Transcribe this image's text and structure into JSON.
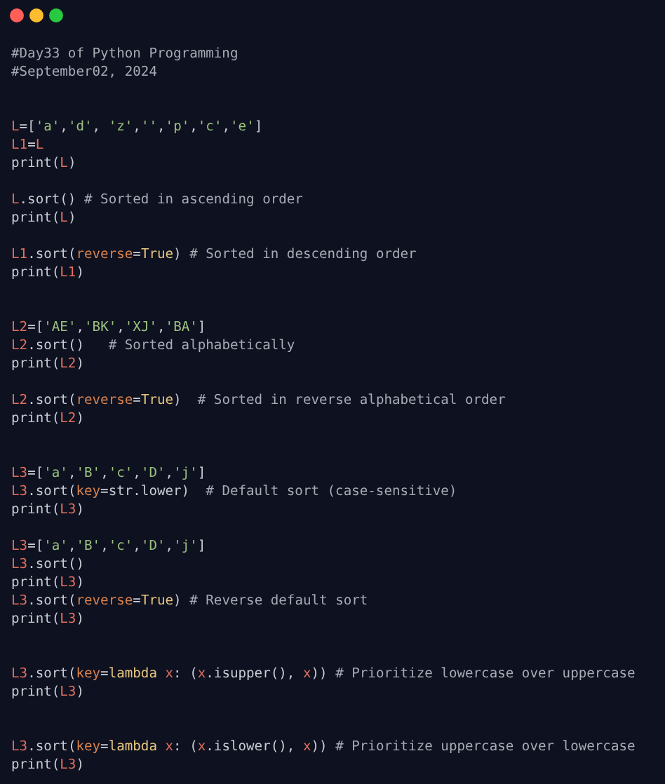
{
  "window": {
    "controls": [
      {
        "kind": "close"
      },
      {
        "kind": "minimize"
      },
      {
        "kind": "maximize"
      }
    ]
  },
  "lines": [
    {
      "kind": "code",
      "tokens": [
        {
          "kind": "comment",
          "text": "#Day33 of Python Programming"
        }
      ]
    },
    {
      "kind": "code",
      "tokens": [
        {
          "kind": "comment",
          "text": "#September02, 2024"
        }
      ]
    },
    {
      "kind": "blank"
    },
    {
      "kind": "blank"
    },
    {
      "kind": "code",
      "tokens": [
        {
          "kind": "var",
          "text": "L"
        },
        {
          "kind": "plain",
          "text": "=["
        },
        {
          "kind": "str",
          "text": "'a'"
        },
        {
          "kind": "plain",
          "text": ","
        },
        {
          "kind": "str",
          "text": "'d'"
        },
        {
          "kind": "plain",
          "text": ", "
        },
        {
          "kind": "str",
          "text": "'z'"
        },
        {
          "kind": "plain",
          "text": ","
        },
        {
          "kind": "str",
          "text": "''"
        },
        {
          "kind": "plain",
          "text": ","
        },
        {
          "kind": "str",
          "text": "'p'"
        },
        {
          "kind": "plain",
          "text": ","
        },
        {
          "kind": "str",
          "text": "'c'"
        },
        {
          "kind": "plain",
          "text": ","
        },
        {
          "kind": "str",
          "text": "'e'"
        },
        {
          "kind": "plain",
          "text": "]"
        }
      ]
    },
    {
      "kind": "code",
      "tokens": [
        {
          "kind": "var",
          "text": "L1"
        },
        {
          "kind": "plain",
          "text": "="
        },
        {
          "kind": "var",
          "text": "L"
        }
      ]
    },
    {
      "kind": "code",
      "tokens": [
        {
          "kind": "plain",
          "text": "print("
        },
        {
          "kind": "var",
          "text": "L"
        },
        {
          "kind": "plain",
          "text": ")"
        }
      ]
    },
    {
      "kind": "blank"
    },
    {
      "kind": "code",
      "tokens": [
        {
          "kind": "var",
          "text": "L"
        },
        {
          "kind": "plain",
          "text": ".sort() "
        },
        {
          "kind": "comment",
          "text": "# Sorted in ascending order"
        }
      ]
    },
    {
      "kind": "code",
      "tokens": [
        {
          "kind": "plain",
          "text": "print("
        },
        {
          "kind": "var",
          "text": "L"
        },
        {
          "kind": "plain",
          "text": ")"
        }
      ]
    },
    {
      "kind": "blank"
    },
    {
      "kind": "code",
      "tokens": [
        {
          "kind": "var",
          "text": "L1"
        },
        {
          "kind": "plain",
          "text": ".sort("
        },
        {
          "kind": "param",
          "text": "reverse"
        },
        {
          "kind": "plain",
          "text": "="
        },
        {
          "kind": "const",
          "text": "True"
        },
        {
          "kind": "plain",
          "text": ") "
        },
        {
          "kind": "comment",
          "text": "# Sorted in descending order"
        }
      ]
    },
    {
      "kind": "code",
      "tokens": [
        {
          "kind": "plain",
          "text": "print("
        },
        {
          "kind": "var",
          "text": "L1"
        },
        {
          "kind": "plain",
          "text": ")"
        }
      ]
    },
    {
      "kind": "blank"
    },
    {
      "kind": "blank"
    },
    {
      "kind": "code",
      "tokens": [
        {
          "kind": "var",
          "text": "L2"
        },
        {
          "kind": "plain",
          "text": "=["
        },
        {
          "kind": "str",
          "text": "'AE'"
        },
        {
          "kind": "plain",
          "text": ","
        },
        {
          "kind": "str",
          "text": "'BK'"
        },
        {
          "kind": "plain",
          "text": ","
        },
        {
          "kind": "str",
          "text": "'XJ'"
        },
        {
          "kind": "plain",
          "text": ","
        },
        {
          "kind": "str",
          "text": "'BA'"
        },
        {
          "kind": "plain",
          "text": "]"
        }
      ]
    },
    {
      "kind": "code",
      "tokens": [
        {
          "kind": "var",
          "text": "L2"
        },
        {
          "kind": "plain",
          "text": ".sort()   "
        },
        {
          "kind": "comment",
          "text": "# Sorted alphabetically"
        }
      ]
    },
    {
      "kind": "code",
      "tokens": [
        {
          "kind": "plain",
          "text": "print("
        },
        {
          "kind": "var",
          "text": "L2"
        },
        {
          "kind": "plain",
          "text": ")"
        }
      ]
    },
    {
      "kind": "blank"
    },
    {
      "kind": "code",
      "tokens": [
        {
          "kind": "var",
          "text": "L2"
        },
        {
          "kind": "plain",
          "text": ".sort("
        },
        {
          "kind": "param",
          "text": "reverse"
        },
        {
          "kind": "plain",
          "text": "="
        },
        {
          "kind": "const",
          "text": "True"
        },
        {
          "kind": "plain",
          "text": ")  "
        },
        {
          "kind": "comment",
          "text": "# Sorted in reverse alphabetical order"
        }
      ]
    },
    {
      "kind": "code",
      "tokens": [
        {
          "kind": "plain",
          "text": "print("
        },
        {
          "kind": "var",
          "text": "L2"
        },
        {
          "kind": "plain",
          "text": ")"
        }
      ]
    },
    {
      "kind": "blank"
    },
    {
      "kind": "blank"
    },
    {
      "kind": "code",
      "tokens": [
        {
          "kind": "var",
          "text": "L3"
        },
        {
          "kind": "plain",
          "text": "=["
        },
        {
          "kind": "str",
          "text": "'a'"
        },
        {
          "kind": "plain",
          "text": ","
        },
        {
          "kind": "str",
          "text": "'B'"
        },
        {
          "kind": "plain",
          "text": ","
        },
        {
          "kind": "str",
          "text": "'c'"
        },
        {
          "kind": "plain",
          "text": ","
        },
        {
          "kind": "str",
          "text": "'D'"
        },
        {
          "kind": "plain",
          "text": ","
        },
        {
          "kind": "str",
          "text": "'j'"
        },
        {
          "kind": "plain",
          "text": "]"
        }
      ]
    },
    {
      "kind": "code",
      "tokens": [
        {
          "kind": "var",
          "text": "L3"
        },
        {
          "kind": "plain",
          "text": ".sort("
        },
        {
          "kind": "param",
          "text": "key"
        },
        {
          "kind": "plain",
          "text": "=str.lower)  "
        },
        {
          "kind": "comment",
          "text": "# Default sort (case-sensitive)"
        }
      ]
    },
    {
      "kind": "code",
      "tokens": [
        {
          "kind": "plain",
          "text": "print("
        },
        {
          "kind": "var",
          "text": "L3"
        },
        {
          "kind": "plain",
          "text": ")"
        }
      ]
    },
    {
      "kind": "blank"
    },
    {
      "kind": "code",
      "tokens": [
        {
          "kind": "var",
          "text": "L3"
        },
        {
          "kind": "plain",
          "text": "=["
        },
        {
          "kind": "str",
          "text": "'a'"
        },
        {
          "kind": "plain",
          "text": ","
        },
        {
          "kind": "str",
          "text": "'B'"
        },
        {
          "kind": "plain",
          "text": ","
        },
        {
          "kind": "str",
          "text": "'c'"
        },
        {
          "kind": "plain",
          "text": ","
        },
        {
          "kind": "str",
          "text": "'D'"
        },
        {
          "kind": "plain",
          "text": ","
        },
        {
          "kind": "str",
          "text": "'j'"
        },
        {
          "kind": "plain",
          "text": "]"
        }
      ]
    },
    {
      "kind": "code",
      "tokens": [
        {
          "kind": "var",
          "text": "L3"
        },
        {
          "kind": "plain",
          "text": ".sort()"
        }
      ]
    },
    {
      "kind": "code",
      "tokens": [
        {
          "kind": "plain",
          "text": "print("
        },
        {
          "kind": "var",
          "text": "L3"
        },
        {
          "kind": "plain",
          "text": ")"
        }
      ]
    },
    {
      "kind": "code",
      "tokens": [
        {
          "kind": "var",
          "text": "L3"
        },
        {
          "kind": "plain",
          "text": ".sort("
        },
        {
          "kind": "param",
          "text": "reverse"
        },
        {
          "kind": "plain",
          "text": "="
        },
        {
          "kind": "const",
          "text": "True"
        },
        {
          "kind": "plain",
          "text": ") "
        },
        {
          "kind": "comment",
          "text": "# Reverse default sort"
        }
      ]
    },
    {
      "kind": "code",
      "tokens": [
        {
          "kind": "plain",
          "text": "print("
        },
        {
          "kind": "var",
          "text": "L3"
        },
        {
          "kind": "plain",
          "text": ")"
        }
      ]
    },
    {
      "kind": "blank"
    },
    {
      "kind": "blank"
    },
    {
      "kind": "code",
      "tokens": [
        {
          "kind": "var",
          "text": "L3"
        },
        {
          "kind": "plain",
          "text": ".sort("
        },
        {
          "kind": "param",
          "text": "key"
        },
        {
          "kind": "plain",
          "text": "="
        },
        {
          "kind": "const",
          "text": "lambda"
        },
        {
          "kind": "var",
          "text": " x"
        },
        {
          "kind": "plain",
          "text": ": ("
        },
        {
          "kind": "var",
          "text": "x"
        },
        {
          "kind": "plain",
          "text": ".isupper(), "
        },
        {
          "kind": "var",
          "text": "x"
        },
        {
          "kind": "plain",
          "text": ")) "
        },
        {
          "kind": "comment",
          "text": "# Prioritize lowercase over uppercase"
        }
      ]
    },
    {
      "kind": "code",
      "tokens": [
        {
          "kind": "plain",
          "text": "print("
        },
        {
          "kind": "var",
          "text": "L3"
        },
        {
          "kind": "plain",
          "text": ")"
        }
      ]
    },
    {
      "kind": "blank"
    },
    {
      "kind": "blank"
    },
    {
      "kind": "code",
      "tokens": [
        {
          "kind": "var",
          "text": "L3"
        },
        {
          "kind": "plain",
          "text": ".sort("
        },
        {
          "kind": "param",
          "text": "key"
        },
        {
          "kind": "plain",
          "text": "="
        },
        {
          "kind": "const",
          "text": "lambda"
        },
        {
          "kind": "var",
          "text": " x"
        },
        {
          "kind": "plain",
          "text": ": ("
        },
        {
          "kind": "var",
          "text": "x"
        },
        {
          "kind": "plain",
          "text": ".islower(), "
        },
        {
          "kind": "var",
          "text": "x"
        },
        {
          "kind": "plain",
          "text": ")) "
        },
        {
          "kind": "comment",
          "text": "# Prioritize uppercase over lowercase"
        }
      ]
    },
    {
      "kind": "code",
      "tokens": [
        {
          "kind": "plain",
          "text": "print("
        },
        {
          "kind": "var",
          "text": "L3"
        },
        {
          "kind": "plain",
          "text": ")"
        }
      ]
    }
  ]
}
